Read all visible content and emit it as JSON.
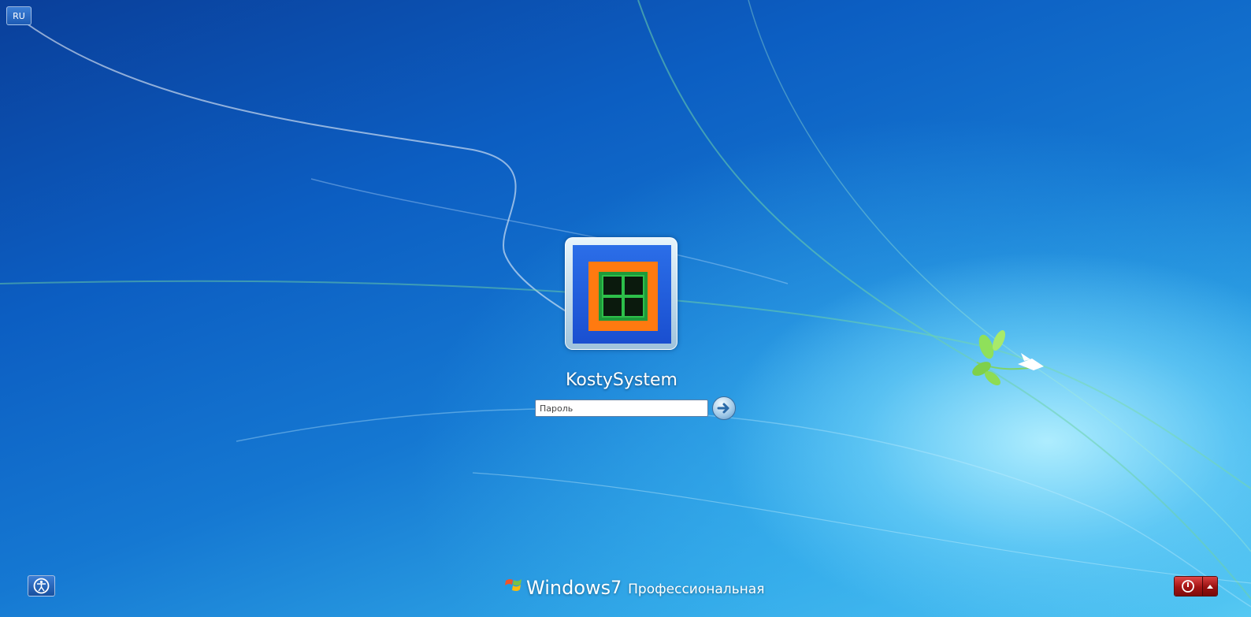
{
  "keyboard_layout": {
    "label": "RU"
  },
  "user": {
    "name": "KostySystem"
  },
  "password": {
    "placeholder": "Пароль",
    "value": ""
  },
  "branding": {
    "word": "Windows",
    "version": "7",
    "edition": "Профессиональная"
  },
  "icons": {
    "submit": "arrow-right-icon",
    "ease_of_access": "ease-of-access-icon",
    "power": "power-icon",
    "power_options": "triangle-up-icon",
    "logo": "windows-flag-icon"
  },
  "colors": {
    "accent": "#1578d2",
    "power_button": "#b01818"
  }
}
